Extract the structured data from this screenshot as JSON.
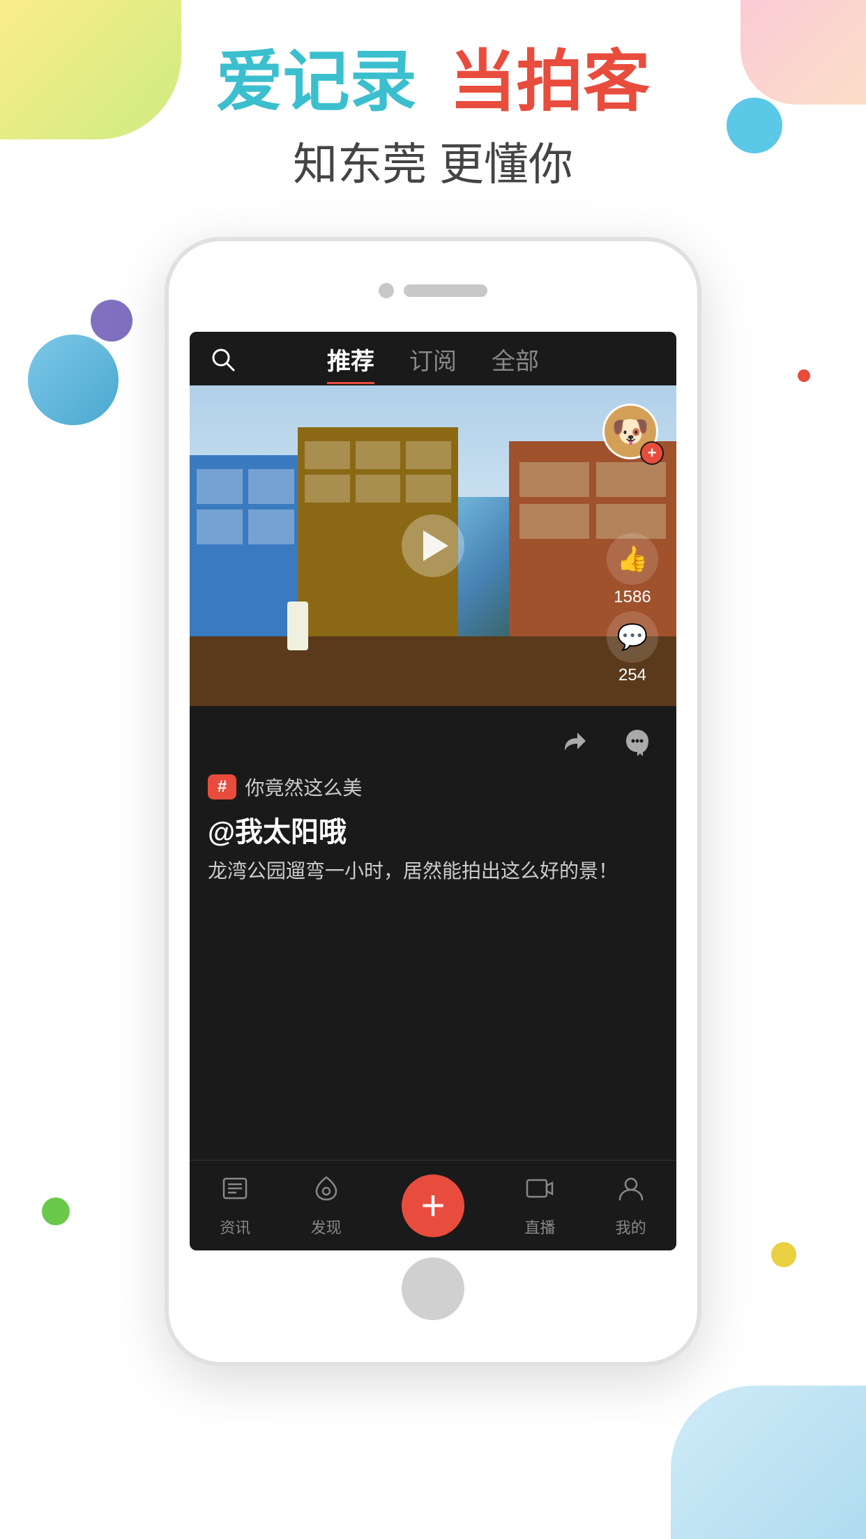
{
  "app": {
    "headline_blue": "爱记录",
    "headline_red": "当拍客",
    "subheadline": "知东莞  更懂你"
  },
  "nav": {
    "tabs": [
      {
        "id": "recommend",
        "label": "推荐",
        "active": true
      },
      {
        "id": "subscribe",
        "label": "订阅",
        "active": false
      },
      {
        "id": "all",
        "label": "全部",
        "active": false
      }
    ],
    "search_icon": "search"
  },
  "video": {
    "likes": "1586",
    "comments": "254",
    "play_icon": "play"
  },
  "post": {
    "share_icon": "share",
    "ghost_icon": "ghost",
    "hashtag": "#",
    "hashtag_text": "你竟然这么美",
    "username": "@我太阳哦",
    "description": "龙湾公园遛弯一小时，居然能拍出这么好的景！"
  },
  "bottom_nav": {
    "items": [
      {
        "id": "news",
        "icon": "📰",
        "label": "资讯"
      },
      {
        "id": "discover",
        "icon": "💙",
        "label": "发现"
      },
      {
        "id": "add",
        "icon": "+",
        "label": ""
      },
      {
        "id": "live",
        "icon": "▶",
        "label": "直播"
      },
      {
        "id": "profile",
        "icon": "👤",
        "label": "我的"
      }
    ]
  }
}
